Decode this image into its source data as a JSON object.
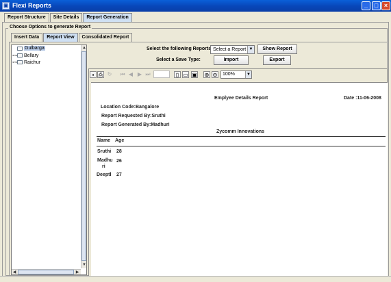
{
  "window": {
    "title": "Flexi Reports",
    "icon": "app-icon",
    "minimize": "_",
    "maximize": "□",
    "close": "×"
  },
  "main_tabs": [
    "Report Structure",
    "Site Details",
    "Report Generation"
  ],
  "group_title": "Choose Options to generate Report",
  "sub_tabs": [
    "Insert Data",
    "Report View",
    "Consolidated Report"
  ],
  "tree": {
    "root": "Gulbarga",
    "children": [
      "Bellary",
      "Raichur"
    ]
  },
  "options": {
    "select_reports_label": "Select the following Reports:",
    "report_select_value": "Select a Report",
    "show_report_label": "Show Report",
    "save_type_label": "Select a Save Type:",
    "import_label": "Import",
    "export_label": "Export"
  },
  "viewer_toolbar": {
    "icons": [
      "save-icon",
      "print-icon",
      "refresh-icon",
      "first-page-icon",
      "prev-page-icon",
      "next-page-icon",
      "last-page-icon",
      "single-page-icon",
      "fit-width-icon",
      "fit-page-icon",
      "zoom-in-icon",
      "zoom-out-icon"
    ],
    "zoom_value": "100%"
  },
  "report": {
    "title": "Emplyee Details Report",
    "date": "Date :11-06-2008",
    "location": "Location Code:Bangalore",
    "requested_by": "Report Requested By:Sruthi",
    "generated_by": "Report Generated By:Madhuri",
    "company": "Zycomm Innovations",
    "columns": [
      "Name",
      "Age"
    ],
    "rows": [
      {
        "name": "Sruthi",
        "age": "28"
      },
      {
        "name_line1": "Madhu",
        "name_line2": "ri",
        "age": "26"
      },
      {
        "name": "Deeptl",
        "age": "27"
      }
    ]
  }
}
